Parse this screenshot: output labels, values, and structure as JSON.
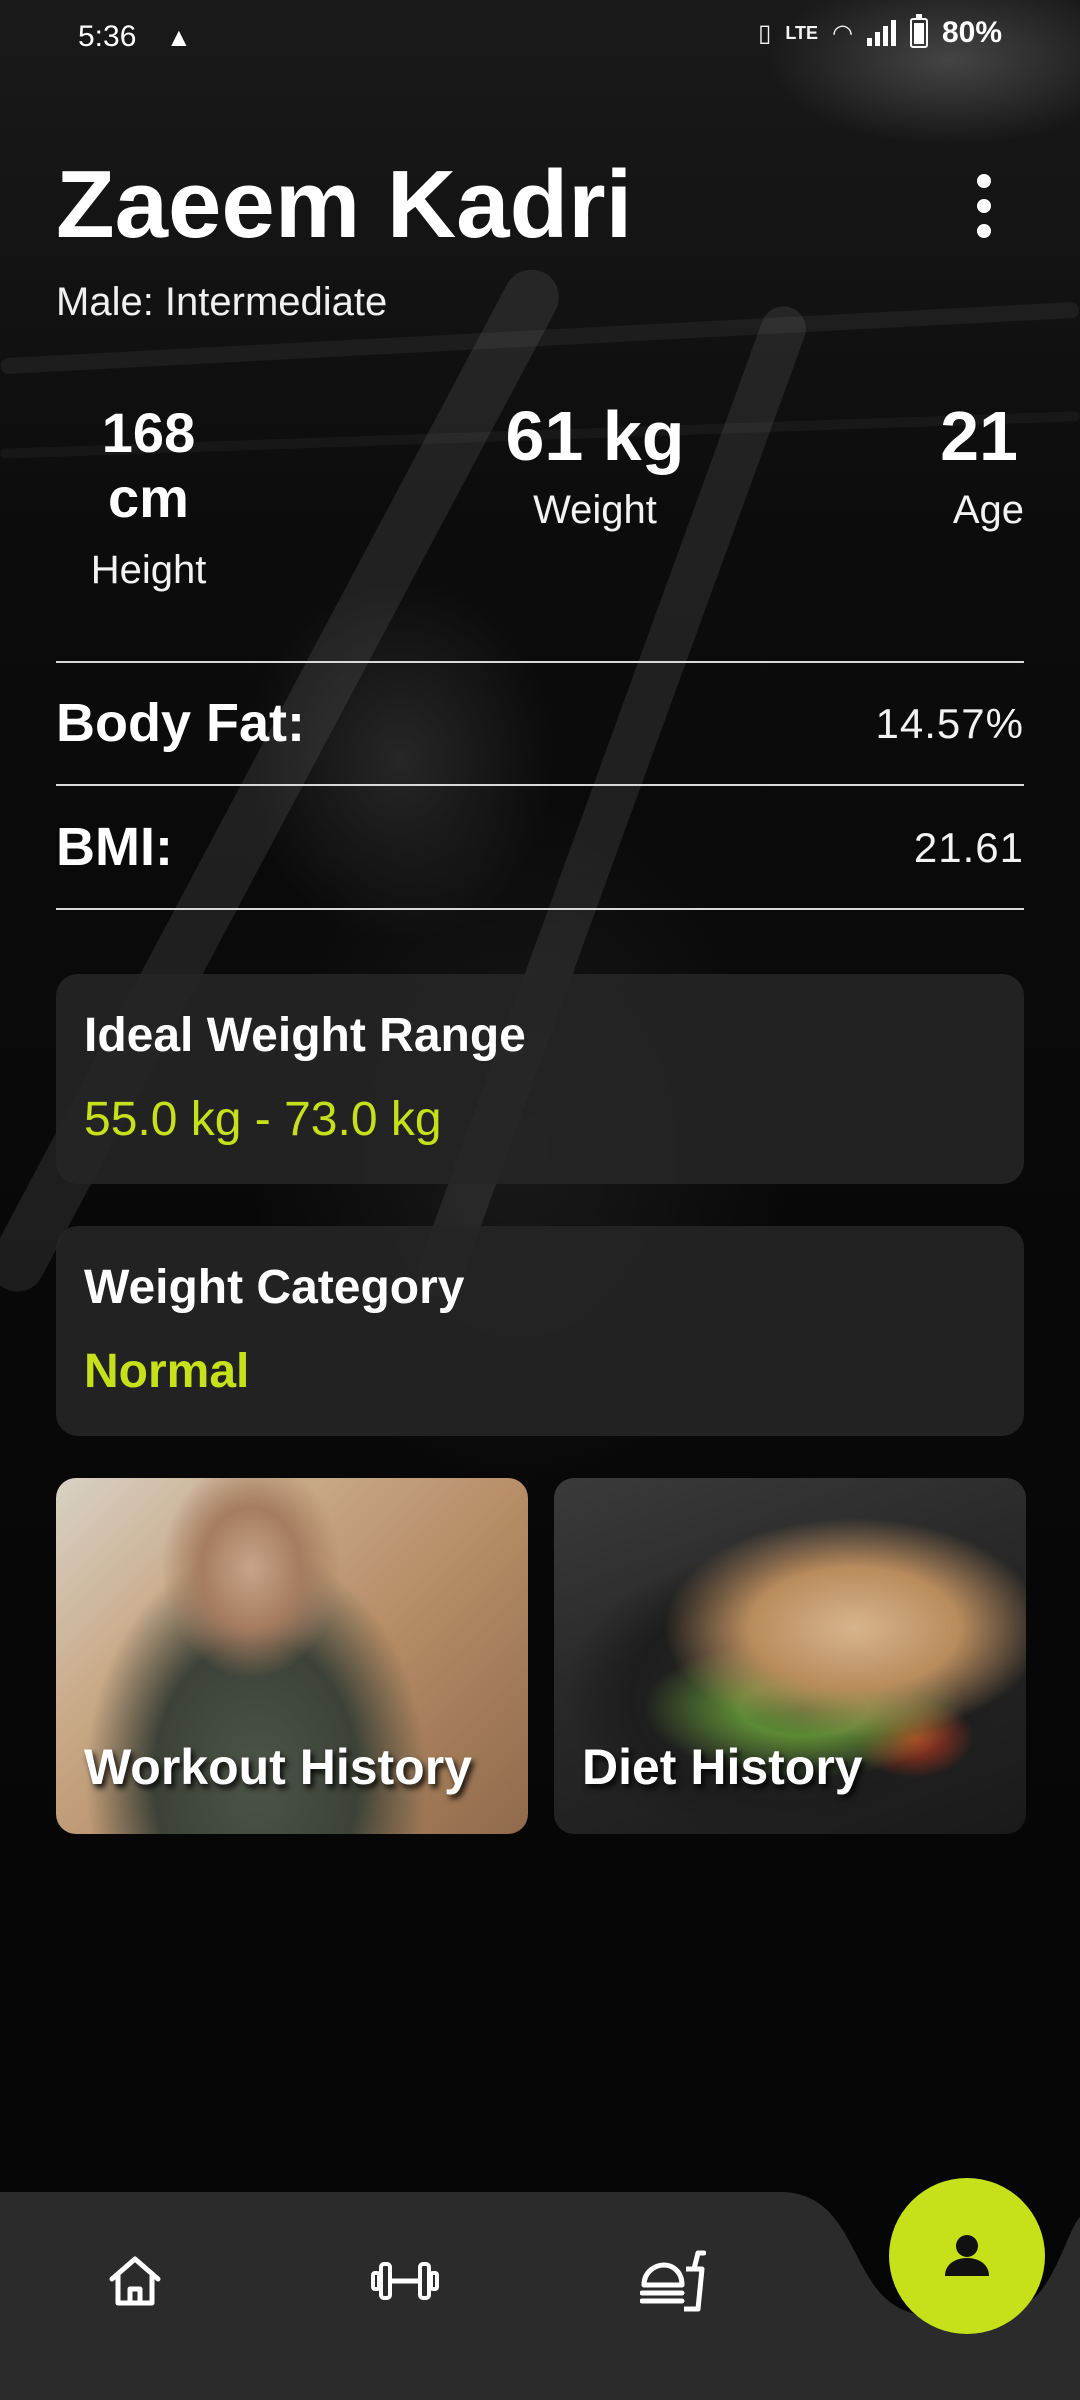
{
  "status_bar": {
    "time": "5:36",
    "alert_icon": "warning-triangle-icon",
    "network": "LTE",
    "battery": "80%"
  },
  "profile": {
    "name": "Zaeem Kadri",
    "subtitle": "Male: Intermediate"
  },
  "stats": {
    "height": {
      "value": "168 cm",
      "label": "Height"
    },
    "weight": {
      "value": "61 kg",
      "label": "Weight"
    },
    "age": {
      "value": "21",
      "label": "Age"
    }
  },
  "metrics": {
    "body_fat": {
      "label": "Body Fat:",
      "value": "14.57%"
    },
    "bmi": {
      "label": "BMI:",
      "value": "21.61"
    }
  },
  "cards": {
    "ideal_weight": {
      "title": "Ideal Weight Range",
      "value": "55.0 kg - 73.0 kg"
    },
    "weight_category": {
      "title": "Weight Category",
      "value": "Normal"
    }
  },
  "tiles": {
    "workout": {
      "label": "Workout History"
    },
    "diet": {
      "label": "Diet History"
    }
  },
  "nav": {
    "items": [
      {
        "name": "home",
        "icon": "home-icon"
      },
      {
        "name": "workout",
        "icon": "dumbbell-icon"
      },
      {
        "name": "diet",
        "icon": "food-icon"
      },
      {
        "name": "profile",
        "icon": "person-icon",
        "active": true
      }
    ]
  },
  "colors": {
    "accent": "#c6e11a",
    "card_bg": "#262626",
    "nav_bg": "#2b2b2b"
  }
}
